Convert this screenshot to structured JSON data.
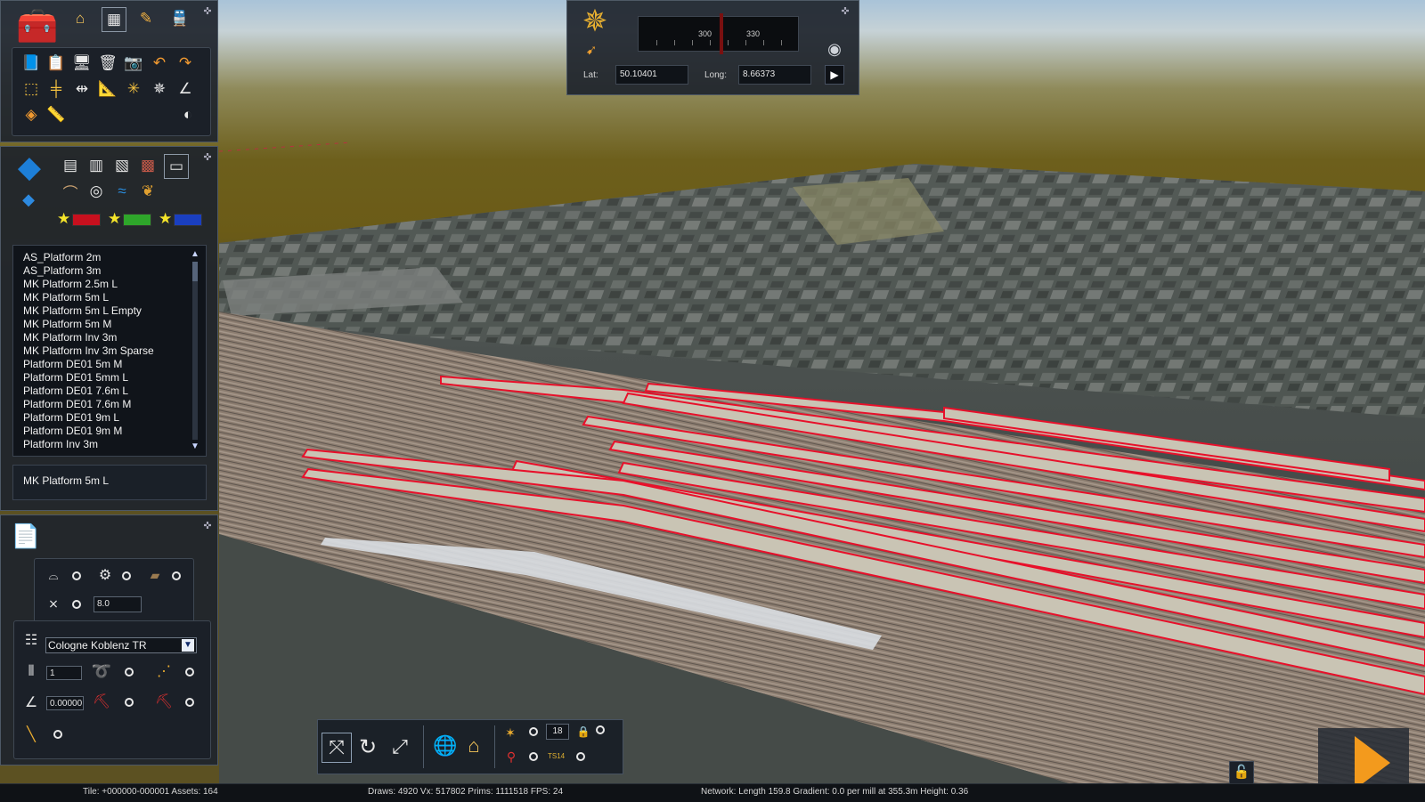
{
  "compass": {
    "heading_label_left": "300",
    "heading_label_right": "330",
    "lat_label": "Lat:",
    "lat_value": "50.10401",
    "long_label": "Long:",
    "long_value": "8.66373"
  },
  "asset_list": {
    "items": [
      "AS_Platform 2m",
      "AS_Platform 3m",
      "MK Platform 2.5m L",
      "MK Platform 5m L",
      "MK Platform 5m L Empty",
      "MK Platform 5m M",
      "MK Platform Inv 3m",
      "MK Platform Inv 3m Sparse",
      "Platform DE01 5m M",
      "Platform DE01 5mm L",
      "Platform DE01 7.6m L",
      "Platform DE01 7.6m M",
      "Platform DE01 9m L",
      "Platform DE01 9m M",
      "Platform Inv 3m"
    ],
    "selected": "MK Platform 5m L"
  },
  "track_tools": {
    "spacing_value": "8.0",
    "track_rule": "Cologne Koblenz TR",
    "count_value": "1",
    "angle_value": "0.00000"
  },
  "bottom_toolbar": {
    "counter_value": "18",
    "ts_label": "TS14"
  },
  "status": {
    "tile": "Tile: +000000-000001  Assets: 164",
    "draws": "Draws: 4920 Vx: 517802 Prims: 1111518 FPS: 24",
    "network": "Network:  Length  159.8 Gradient:  0.0 per mill at 355.3m Height:   0.36"
  },
  "colors": {
    "accent_orange": "#f39a1d",
    "platform_red": "#e8102a",
    "panel_bg": "#1e242c"
  }
}
